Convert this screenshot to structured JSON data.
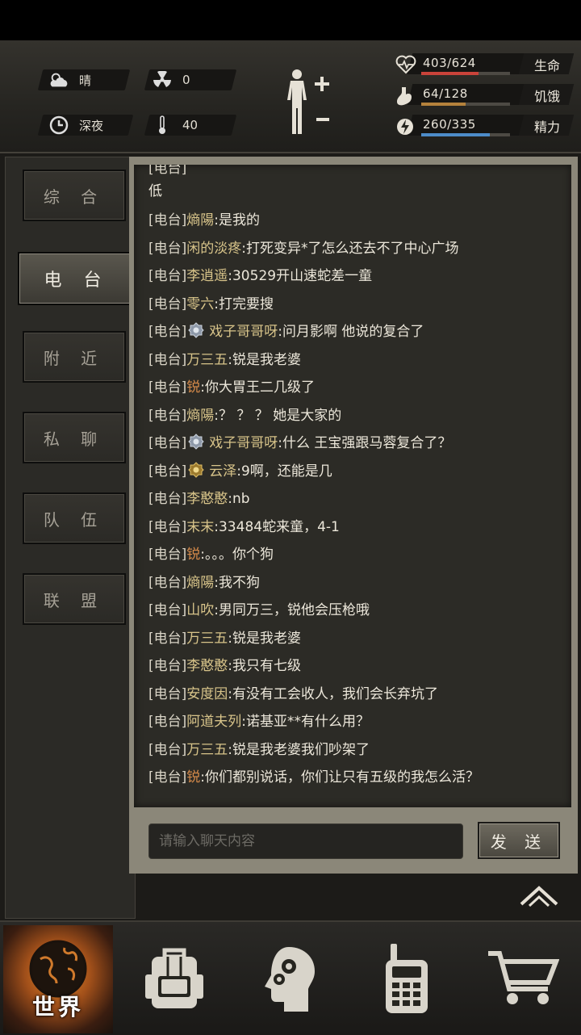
{
  "status": {
    "weather": "晴",
    "radiation": "0",
    "time_of_day": "深夜",
    "temperature": "40"
  },
  "stats": [
    {
      "value": "403/624",
      "label": "生命",
      "current": 403,
      "max": 624,
      "color": "#c9433a"
    },
    {
      "value": "64/128",
      "label": "饥饿",
      "current": 64,
      "max": 128,
      "color": "#b5823c"
    },
    {
      "value": "260/335",
      "label": "精力",
      "current": 260,
      "max": 335,
      "color": "#4d8cc9"
    }
  ],
  "tabs": [
    "综 合",
    "电 台",
    "附 近",
    "私 聊",
    "队 伍",
    "联 盟"
  ],
  "active_tab": 1,
  "chat": {
    "overflow_text": "低",
    "messages": [
      {
        "channel": "[电台]",
        "name": "熵陽",
        "text": ":是我的"
      },
      {
        "channel": "[电台]",
        "name": "闲的淡疼",
        "text": ":打死变异*了怎么还去不了中心广场"
      },
      {
        "channel": "[电台]",
        "name": "李逍遥",
        "text": ":30529开山速蛇差一童"
      },
      {
        "channel": "[电台]",
        "name": "零六",
        "text": ":打完要搜"
      },
      {
        "channel": "[电台]",
        "name": "戏子哥哥呀",
        "text": ":问月影啊 他说的复合了",
        "badge": "silver"
      },
      {
        "channel": "[电台]",
        "name": "万三五",
        "text": ":锐是我老婆"
      },
      {
        "channel": "[电台]",
        "name": "锐",
        "text": ":你大胃王二几级了",
        "orange": true
      },
      {
        "channel": "[电台]",
        "name": "熵陽",
        "text": ":？ ？ ？ 她是大家的"
      },
      {
        "channel": "[电台]",
        "name": "戏子哥哥呀",
        "text": ":什么 王宝强跟马蓉复合了？",
        "badge": "silver"
      },
      {
        "channel": "[电台]",
        "name": "云泽",
        "text": ":9啊，还能是几",
        "badge": "gold"
      },
      {
        "channel": "[电台]",
        "name": "李憨憨",
        "text": ":nb"
      },
      {
        "channel": "[电台]",
        "name": "末末",
        "text": ":33484蛇来童，4-1"
      },
      {
        "channel": "[电台]",
        "name": "锐",
        "text": ":。。。你个狗",
        "orange": true
      },
      {
        "channel": "[电台]",
        "name": "熵陽",
        "text": ":我不狗"
      },
      {
        "channel": "[电台]",
        "name": "山吹",
        "text": ":男同万三，锐他会压枪哦"
      },
      {
        "channel": "[电台]",
        "name": "万三五",
        "text": ":锐是我老婆"
      },
      {
        "channel": "[电台]",
        "name": "李憨憨",
        "text": ":我只有七级"
      },
      {
        "channel": "[电台]",
        "name": "安度因",
        "text": ":有没有工会收人，我们会长弃坑了"
      },
      {
        "channel": "[电台]",
        "name": "阿道夫列",
        "text": ":诺基亚**有什么用？"
      },
      {
        "channel": "[电台]",
        "name": "万三五",
        "text": ":锐是我老婆我们吵架了"
      },
      {
        "channel": "[电台]",
        "name": "锐",
        "text": ":你们都别说话，你们让只有五级的我怎么活？",
        "orange": true
      }
    ],
    "input_placeholder": "请输入聊天内容",
    "send_label": "发 送"
  },
  "bottom_nav": {
    "world_label": "世界",
    "icons": [
      "globe-icon",
      "backpack-icon",
      "skills-head-icon",
      "radio-icon",
      "cart-icon"
    ]
  }
}
